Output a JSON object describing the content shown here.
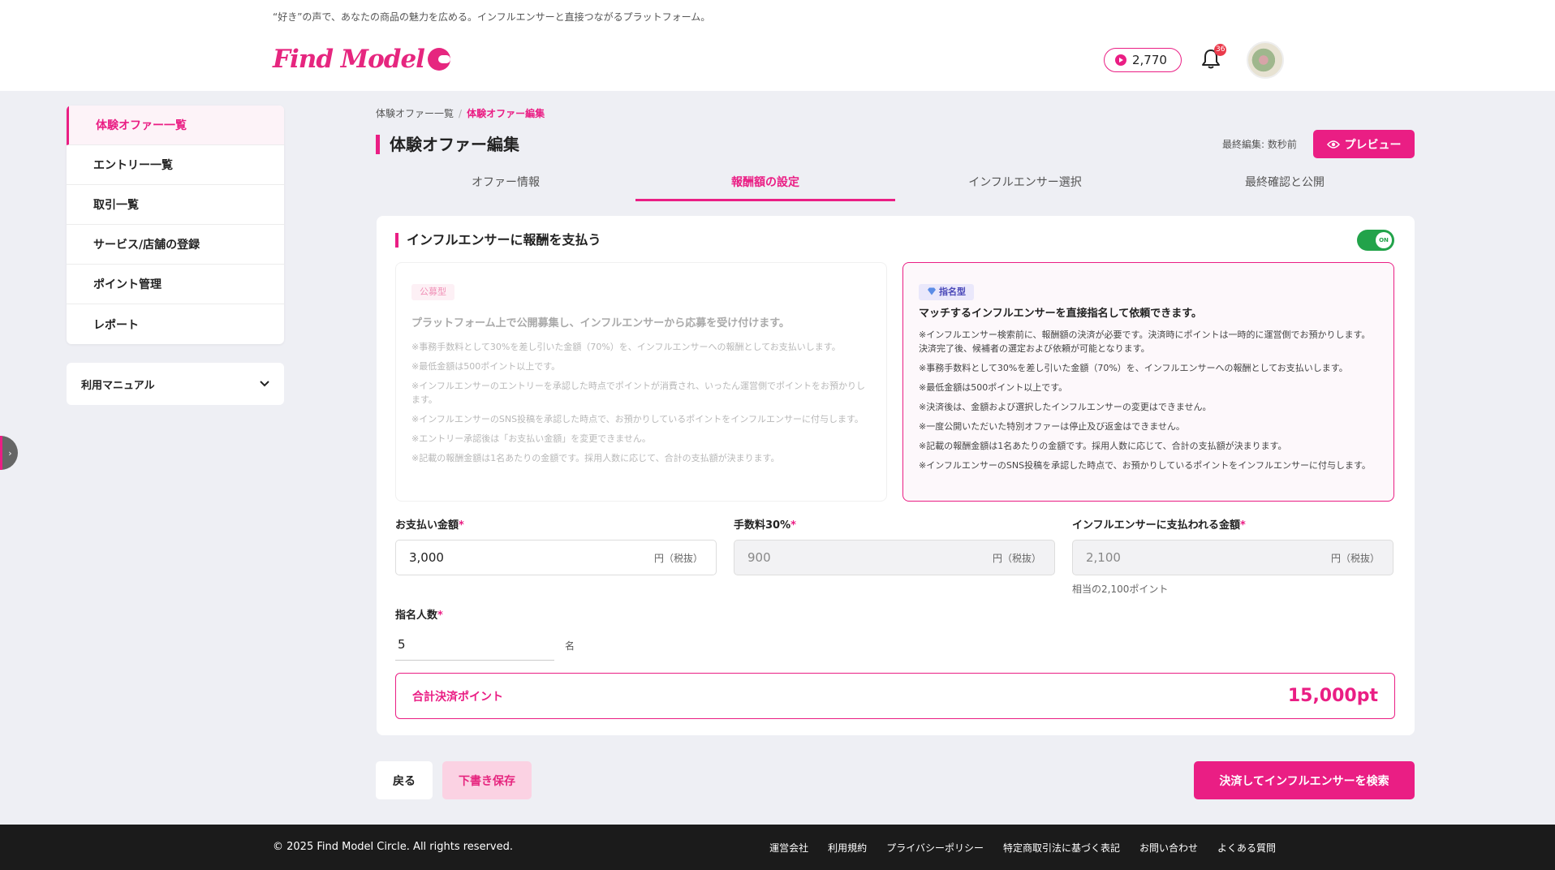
{
  "header": {
    "tagline": "“好き”の声で、あなたの商品の魅力を広める。インフルエンサーと直接つながるプラットフォーム。",
    "logo_text": "Find Model",
    "points": "2,770",
    "notification_count": "36"
  },
  "sidebar": {
    "items": [
      {
        "label": "体験オファー一覧"
      },
      {
        "label": "エントリー一覧"
      },
      {
        "label": "取引一覧"
      },
      {
        "label": "サービス/店舗の登録"
      },
      {
        "label": "ポイント管理"
      },
      {
        "label": "レポート"
      }
    ],
    "manual_label": "利用マニュアル"
  },
  "breadcrumb": {
    "parent": "体験オファー一覧",
    "separator": "/",
    "current": "体験オファー編集"
  },
  "page": {
    "title": "体験オファー編集",
    "last_edited": "最終編集: 数秒前",
    "preview_label": "プレビュー"
  },
  "tabs": [
    {
      "label": "オファー情報"
    },
    {
      "label": "報酬額の設定"
    },
    {
      "label": "インフルエンサー選択"
    },
    {
      "label": "最終確認と公開"
    }
  ],
  "reward": {
    "section_title": "インフルエンサーに報酬を支払う",
    "toggle_label": "ON",
    "public_option": {
      "badge": "公募型",
      "heading": "プラットフォーム上で公開募集し、インフルエンサーから応募を受け付けます。",
      "notes": [
        "※事務手数料として30%を差し引いた金額（70%）を、インフルエンサーへの報酬としてお支払いします。",
        "※最低金額は500ポイント以上です。",
        "※インフルエンサーのエントリーを承認した時点でポイントが消費され、いったん運営側でポイントをお預かりします。",
        "※インフルエンサーのSNS投稿を承認した時点で、お預かりしているポイントをインフルエンサーに付与します。",
        "※エントリー承認後は「お支払い金額」を変更できません。",
        "※記載の報酬金額は1名あたりの金額です。採用人数に応じて、合計の支払額が決まります。"
      ]
    },
    "named_option": {
      "badge": "指名型",
      "heading": "マッチするインフルエンサーを直接指名して依頼できます。",
      "notes": [
        "※インフルエンサー検索前に、報酬額の決済が必要です。決済時にポイントは一時的に運営側でお預かりします。決済完了後、候補者の選定および依頼が可能となります。",
        "※事務手数料として30%を差し引いた金額（70%）を、インフルエンサーへの報酬としてお支払いします。",
        "※最低金額は500ポイント以上です。",
        "※決済後は、金額および選択したインフルエンサーの変更はできません。",
        "※一度公開いただいた特別オファーは停止及び返金はできません。",
        "※記載の報酬金額は1名あたりの金額です。採用人数に応じて、合計の支払額が決まります。",
        "※インフルエンサーのSNS投稿を承認した時点で、お預かりしているポイントをインフルエンサーに付与します。"
      ]
    },
    "fields": {
      "payment": {
        "label": "お支払い金額",
        "value": "3,000",
        "unit": "円（税抜）"
      },
      "fee": {
        "label": "手数料30%",
        "value": "900",
        "unit": "円（税抜）"
      },
      "influencer_amount": {
        "label": "インフルエンサーに支払われる金額",
        "value": "2,100",
        "unit": "円（税抜）",
        "hint": "相当の2,100ポイント"
      },
      "required_mark": "*"
    },
    "count": {
      "label": "指名人数",
      "value": "5",
      "unit": "名"
    },
    "total": {
      "label": "合計決済ポイント",
      "value": "15,000pt"
    }
  },
  "actions": {
    "back": "戻る",
    "save_draft": "下書き保存",
    "submit": "決済してインフルエンサーを検索"
  },
  "footer": {
    "copyright": "© 2025 Find Model Circle. All rights reserved.",
    "links": [
      {
        "label": "運営会社"
      },
      {
        "label": "利用規約"
      },
      {
        "label": "プライバシーポリシー"
      },
      {
        "label": "特定商取引法に基づく表記"
      },
      {
        "label": "お問い合わせ"
      },
      {
        "label": "よくある質問"
      }
    ]
  },
  "colors": {
    "accent": "#ea1e84",
    "toggle_on": "#22a34a",
    "footer_bg": "#1b1b1b",
    "page_bg": "#eeeff4"
  }
}
